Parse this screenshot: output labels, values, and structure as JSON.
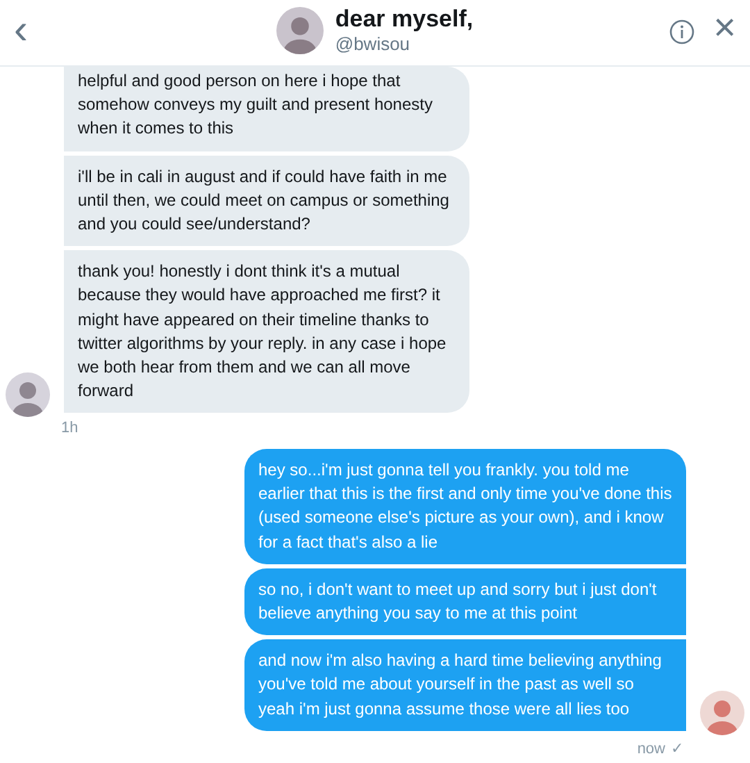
{
  "header": {
    "back": "‹",
    "title": "dear myself,",
    "handle": "@bwisou",
    "close": "×"
  },
  "groups": [
    {
      "kind": "received",
      "messages": [
        "helpful and good person on here i hope that somehow conveys my guilt and present honesty when it comes to this",
        "i'll be in cali in august and if could have faith in me until then, we could meet on campus or something and you could see/understand?",
        "thank you! honestly i dont think it's a mutual because they would have approached me first? it might have appeared on their timeline thanks to twitter algorithms by your reply. in any case i hope we both hear from them and we can all move forward"
      ],
      "time": "1h"
    },
    {
      "kind": "sent",
      "messages": [
        "hey so...i'm just gonna tell you frankly. you told me earlier that this is the first and only time you've done this (used someone else's picture as your own), and i know for a fact that's also a lie",
        "so no, i don't want to meet up and sorry but i just don't believe anything you say to me at this point",
        "and now i'm also having a hard time believing anything you've told me about yourself in the past as well so yeah i'm just gonna assume those were all lies too"
      ],
      "time": "now",
      "receipt": "✓"
    }
  ]
}
